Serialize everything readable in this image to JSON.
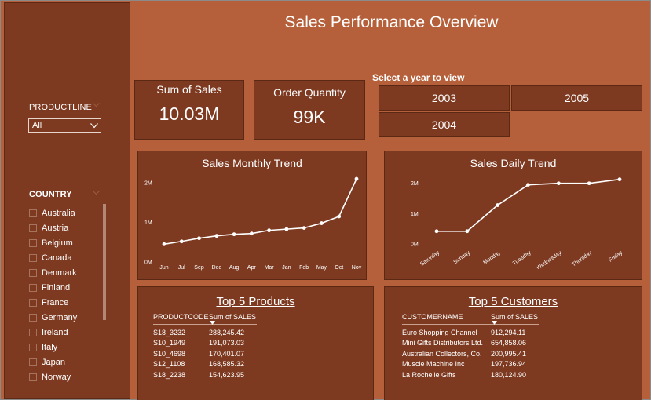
{
  "title": "Sales Performance Overview",
  "filters": {
    "productline": {
      "label": "PRODUCTLINE",
      "selected": "All"
    },
    "country": {
      "label": "COUNTRY",
      "items": [
        "Australia",
        "Austria",
        "Belgium",
        "Canada",
        "Denmark",
        "Finland",
        "France",
        "Germany",
        "Ireland",
        "Italy",
        "Japan",
        "Norway"
      ]
    }
  },
  "kpis": {
    "sales": {
      "label": "Sum of Sales",
      "value": "10.03M"
    },
    "quantity": {
      "label": "Order Quantity",
      "value": "99K"
    }
  },
  "year_selector": {
    "label": "Select a year to view",
    "options": [
      "2003",
      "2005",
      "2004"
    ]
  },
  "colors": {
    "background": "#b5603a",
    "panel": "#7d3a21",
    "text": "#ffffff"
  },
  "chart_data": [
    {
      "type": "line",
      "title": "Sales Monthly Trend",
      "categories": [
        "Jun",
        "Jul",
        "Sep",
        "Dec",
        "Aug",
        "Apr",
        "Mar",
        "Jan",
        "Feb",
        "May",
        "Oct",
        "Nov"
      ],
      "values": [
        0.45,
        0.52,
        0.6,
        0.66,
        0.7,
        0.72,
        0.8,
        0.83,
        0.86,
        0.98,
        1.15,
        2.1
      ],
      "yticks": [
        "0M",
        "1M",
        "2M"
      ],
      "ylim": [
        0,
        2.2
      ],
      "grid": false
    },
    {
      "type": "line",
      "title": "Sales Daily Trend",
      "categories": [
        "Saturday",
        "Sunday",
        "Monday",
        "Tuesday",
        "Wednesday",
        "Thursday",
        "Friday"
      ],
      "values": [
        0.42,
        0.42,
        1.28,
        1.95,
        2.0,
        2.0,
        2.13
      ],
      "yticks": [
        "0M",
        "1M",
        "2M"
      ],
      "ylim": [
        0,
        2.2
      ],
      "grid": false
    }
  ],
  "top_products": {
    "title": "Top 5 Products",
    "columns": [
      "PRODUCTCODE",
      "Sum of SALES"
    ],
    "rows": [
      [
        "S18_3232",
        "288,245.42"
      ],
      [
        "S10_1949",
        "191,073.03"
      ],
      [
        "S10_4698",
        "170,401.07"
      ],
      [
        "S12_1108",
        "168,585.32"
      ],
      [
        "S18_2238",
        "154,623.95"
      ]
    ]
  },
  "top_customers": {
    "title": "Top 5 Customers",
    "columns": [
      "CUSTOMERNAME",
      "Sum of SALES"
    ],
    "rows": [
      [
        "Euro Shopping Channel",
        "912,294.11"
      ],
      [
        "Mini Gifts Distributors Ltd.",
        "654,858.06"
      ],
      [
        "Australian Collectors, Co.",
        "200,995.41"
      ],
      [
        "Muscle Machine Inc",
        "197,736.94"
      ],
      [
        "La Rochelle Gifts",
        "180,124.90"
      ]
    ]
  }
}
